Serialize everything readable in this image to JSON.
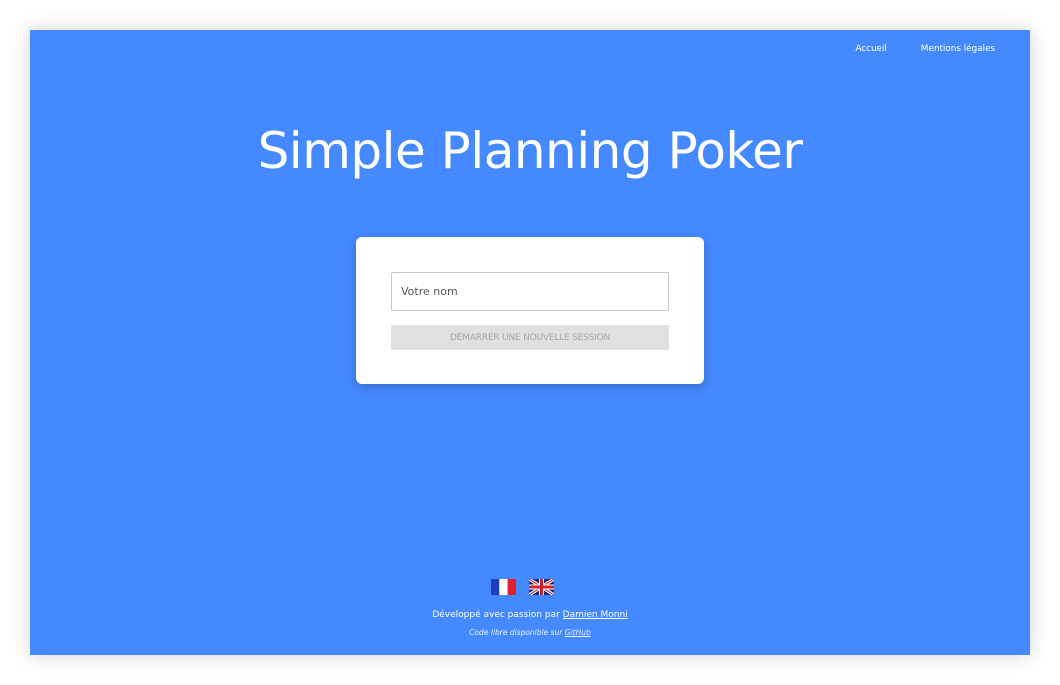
{
  "nav": {
    "home_label": "Accueil",
    "legal_label": "Mentions légales"
  },
  "hero": {
    "title": "Simple Planning Poker"
  },
  "form": {
    "name_placeholder": "Votre nom",
    "name_value": "",
    "start_button_label": "DÉMARRER UNE NOUVELLE SESSION"
  },
  "languages": [
    {
      "icon": "french-flag-icon",
      "lang": "fr"
    },
    {
      "icon": "uk-flag-icon",
      "lang": "en"
    }
  ],
  "footer": {
    "developed_text": "Développé avec passion par",
    "author_link": "Damien Monni",
    "source_text": "Code libre disponible sur",
    "github_link": "GitHub"
  },
  "colors": {
    "background": "#4589ff",
    "card": "#ffffff",
    "button_disabled": "#e0e0e0",
    "button_text_disabled": "#a6a6a6",
    "text_light": "#ffffff"
  }
}
